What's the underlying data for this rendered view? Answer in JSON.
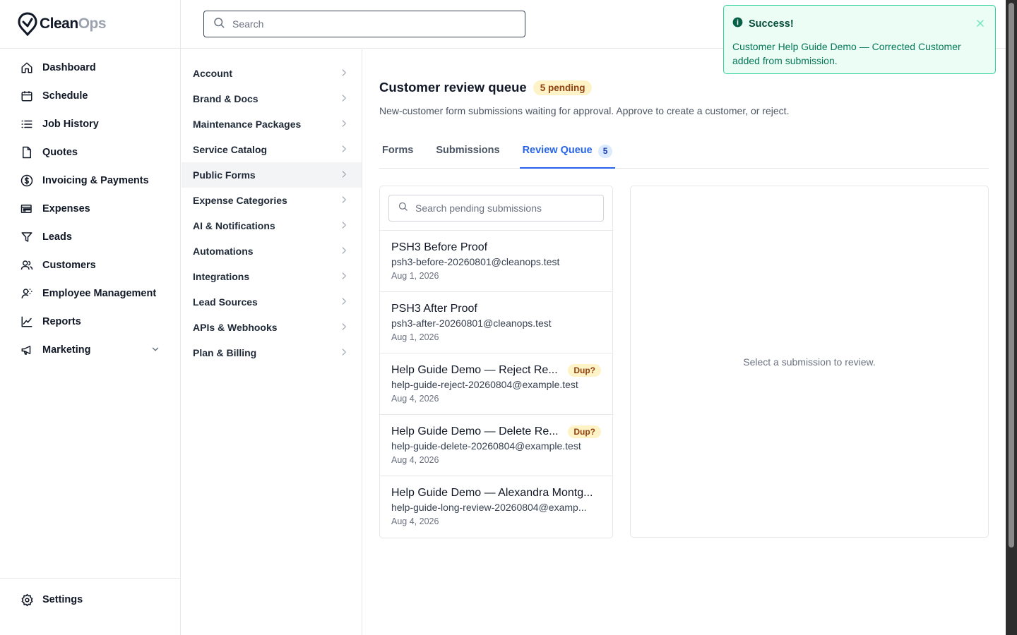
{
  "app": {
    "logo_primary": "Clean",
    "logo_secondary": "Ops",
    "search_placeholder": "Search"
  },
  "sidebar": {
    "items": [
      {
        "label": "Dashboard",
        "icon": "home-icon"
      },
      {
        "label": "Schedule",
        "icon": "calendar-icon"
      },
      {
        "label": "Job History",
        "icon": "list-icon"
      },
      {
        "label": "Quotes",
        "icon": "document-icon"
      },
      {
        "label": "Invoicing & Payments",
        "icon": "dollar-circle-icon"
      },
      {
        "label": "Expenses",
        "icon": "receipt-icon"
      },
      {
        "label": "Leads",
        "icon": "funnel-icon"
      },
      {
        "label": "Customers",
        "icon": "users-icon"
      },
      {
        "label": "Employee Management",
        "icon": "user-gear-icon"
      },
      {
        "label": "Reports",
        "icon": "chart-line-icon"
      },
      {
        "label": "Marketing",
        "icon": "megaphone-icon"
      }
    ],
    "settings_label": "Settings"
  },
  "settings_menu": {
    "items": [
      "Account",
      "Brand & Docs",
      "Maintenance Packages",
      "Service Catalog",
      "Public Forms",
      "Expense Categories",
      "AI & Notifications",
      "Automations",
      "Integrations",
      "Lead Sources",
      "APIs & Webhooks",
      "Plan & Billing"
    ],
    "active": "Public Forms"
  },
  "main": {
    "title": "Customer review queue",
    "pending_badge": "5 pending",
    "subtitle": "New-customer form submissions waiting for approval. Approve to create a customer, or reject.",
    "tabs": [
      {
        "label": "Forms"
      },
      {
        "label": "Submissions"
      },
      {
        "label": "Review Queue",
        "count": "5"
      }
    ],
    "active_tab": "Review Queue",
    "list_search_placeholder": "Search pending submissions",
    "submissions": [
      {
        "name": "PSH3 Before Proof",
        "email": "psh3-before-20260801@cleanops.test",
        "date": "Aug 1, 2026",
        "badge": ""
      },
      {
        "name": "PSH3 After Proof",
        "email": "psh3-after-20260801@cleanops.test",
        "date": "Aug 1, 2026",
        "badge": ""
      },
      {
        "name": "Help Guide Demo — Reject Re...",
        "email": "help-guide-reject-20260804@example.test",
        "date": "Aug 4, 2026",
        "badge": "Dup?"
      },
      {
        "name": "Help Guide Demo — Delete Re...",
        "email": "help-guide-delete-20260804@example.test",
        "date": "Aug 4, 2026",
        "badge": "Dup?"
      },
      {
        "name": "Help Guide Demo — Alexandra Montg...",
        "email": "help-guide-long-review-20260804@examp...",
        "date": "Aug 4, 2026",
        "badge": ""
      }
    ],
    "detail_empty": "Select a submission to review."
  },
  "toast": {
    "title": "Success!",
    "message": "Customer Help Guide Demo — Corrected Customer added from submission."
  },
  "colors": {
    "accent": "#2563eb",
    "success_bg": "#ecfdf5",
    "success_border": "#34d399",
    "warning_bg": "#fef3c7",
    "warning_text": "#92400e"
  }
}
